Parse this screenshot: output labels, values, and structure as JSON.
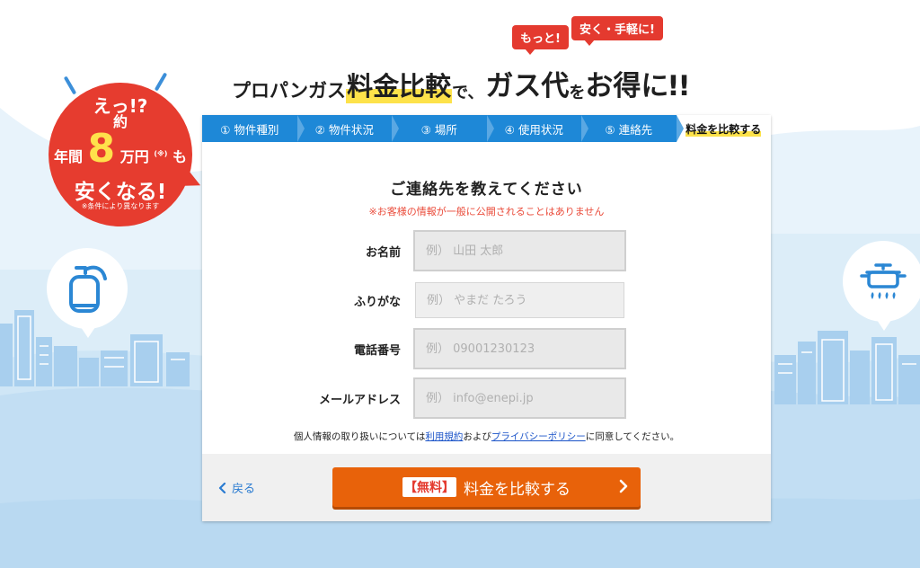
{
  "colors": {
    "brand_blue": "#1e88d7",
    "accent_orange": "#e8620a",
    "badge_red": "#e63c2f",
    "highlight_yellow": "#fde24a",
    "sky_blue": "#c9e3f5"
  },
  "header": {
    "bubble_1": "もっと!",
    "bubble_2": "安く・手軽に!",
    "headline_part_1": "プロパンガス",
    "headline_highlight": "料金比較",
    "headline_part_2": "で、",
    "headline_part_3": "ガス代",
    "headline_part_4": "を",
    "headline_part_5": "お得",
    "headline_part_6": "に!!"
  },
  "badge": {
    "line_1": "えっ!?",
    "prefix_approx": "約",
    "prefix_year": "年間",
    "amount": "8",
    "unit": "万円",
    "note_mark": "(※)",
    "suffix": "も",
    "line_3": "安くなる!",
    "footnote": "※条件により異なります"
  },
  "icons": {
    "left": "gas-cylinder-icon",
    "right": "pot-stove-icon"
  },
  "steps": [
    {
      "label": "① 物件種別"
    },
    {
      "label": "② 物件状況"
    },
    {
      "label": "③ 場所"
    },
    {
      "label": "④ 使用状況"
    },
    {
      "label": "⑤ 連絡先"
    },
    {
      "label": "料金を比較する"
    }
  ],
  "form": {
    "title": "ご連絡先を教えてください",
    "notice": "※お客様の情報が一般に公開されることはありません",
    "fields": [
      {
        "label": "お名前",
        "placeholder": "例） 山田 太郎",
        "value": ""
      },
      {
        "label": "ふりがな",
        "placeholder": "例） やまだ たろう",
        "value": ""
      },
      {
        "label": "電話番号",
        "placeholder": "例） 09001230123",
        "value": ""
      },
      {
        "label": "メールアドレス",
        "placeholder": "例） info@enepi.jp",
        "value": ""
      }
    ],
    "consent_prefix": "個人情報の取り扱いについては",
    "consent_link_terms": "利用規約",
    "consent_and": "および",
    "consent_link_privacy": "プライバシーポリシー",
    "consent_suffix": "に同意してください。"
  },
  "footer": {
    "back_label": "戻る",
    "submit_tag": "【無料】",
    "submit_label": "料金を比較する"
  }
}
